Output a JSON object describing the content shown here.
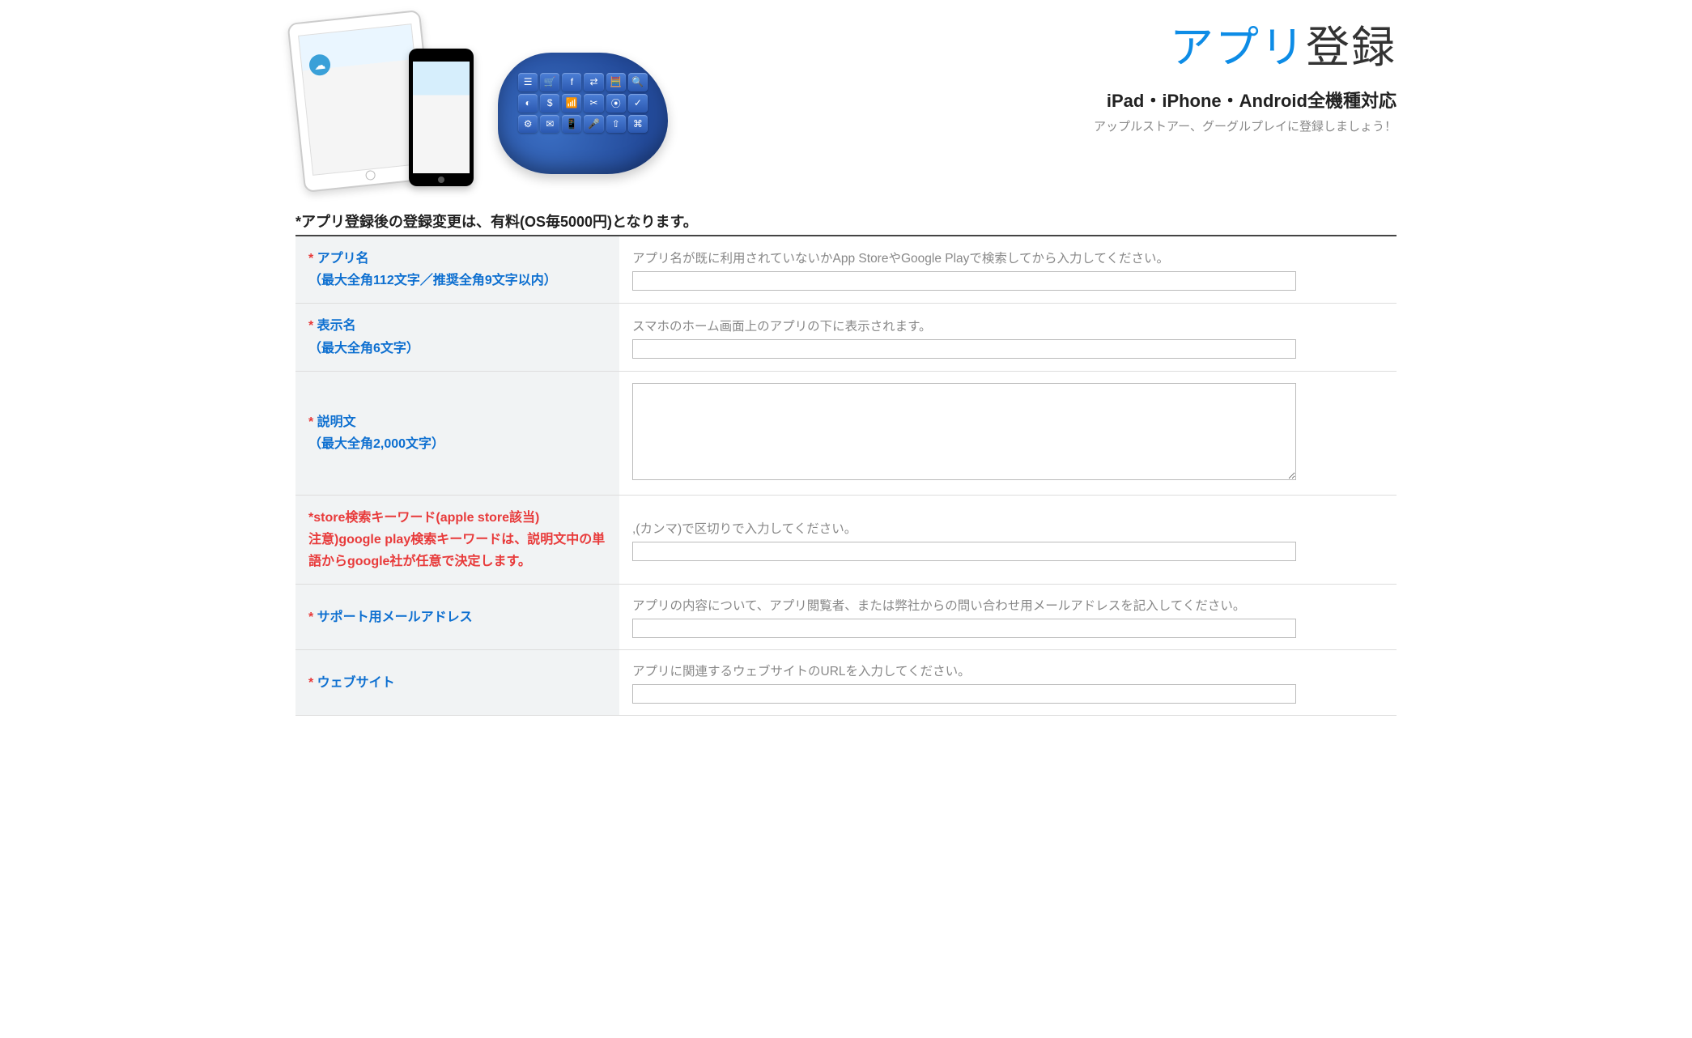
{
  "header": {
    "title_accent": "アプリ",
    "title_dark": "登録",
    "subtitle": "iPad・iPhone・Android全機種対応",
    "tagline": "アップルストアー、グーグルプレイに登録しましょう！"
  },
  "notice": "*アプリ登録後の登録変更は、有料(OS毎5000円)となります。",
  "required_mark": "*",
  "cloud_icons": [
    "☰",
    "🛒",
    "f",
    "⇄",
    "🧮",
    "🔍",
    "◐",
    "$",
    "📶",
    "✂",
    "⦿",
    "✓",
    "⚙",
    "✉",
    "📱",
    "🎤",
    "⇧",
    "⌘"
  ],
  "rows": [
    {
      "key": "app_name",
      "required": true,
      "label_main": "アプリ名",
      "label_sub": "（最大全角112文字／推奨全角9文字以内）",
      "hint": "アプリ名が既に利用されていないかApp StoreやGoogle Playで検索してから入力してください。",
      "input_type": "text",
      "value": ""
    },
    {
      "key": "display_name",
      "required": true,
      "label_main": "表示名",
      "label_sub": "（最大全角6文字）",
      "hint": "スマホのホーム画面上のアプリの下に表示されます。",
      "input_type": "text",
      "value": ""
    },
    {
      "key": "description",
      "required": true,
      "label_main": "説明文",
      "label_sub": "（最大全角2,000文字）",
      "hint": "",
      "input_type": "textarea",
      "value": ""
    },
    {
      "key": "keywords",
      "required": true,
      "label_red_line1": "store検索キーワード(apple store該当)",
      "label_red_line2": "注意)google play検索キーワードは、説明文中の単語からgoogle社が任意で決定します。",
      "hint": ",(カンマ)で区切りで入力してください。",
      "input_type": "text",
      "value": ""
    },
    {
      "key": "support_email",
      "required": true,
      "label_main": "サポート用メールアドレス",
      "hint": "アプリの内容について、アプリ閲覧者、または弊社からの問い合わせ用メールアドレスを記入してください。",
      "input_type": "text",
      "value": ""
    },
    {
      "key": "website",
      "required": true,
      "label_main": "ウェブサイト",
      "hint": "アプリに関連するウェブサイトのURLを入力してください。",
      "input_type": "text",
      "value": ""
    }
  ]
}
